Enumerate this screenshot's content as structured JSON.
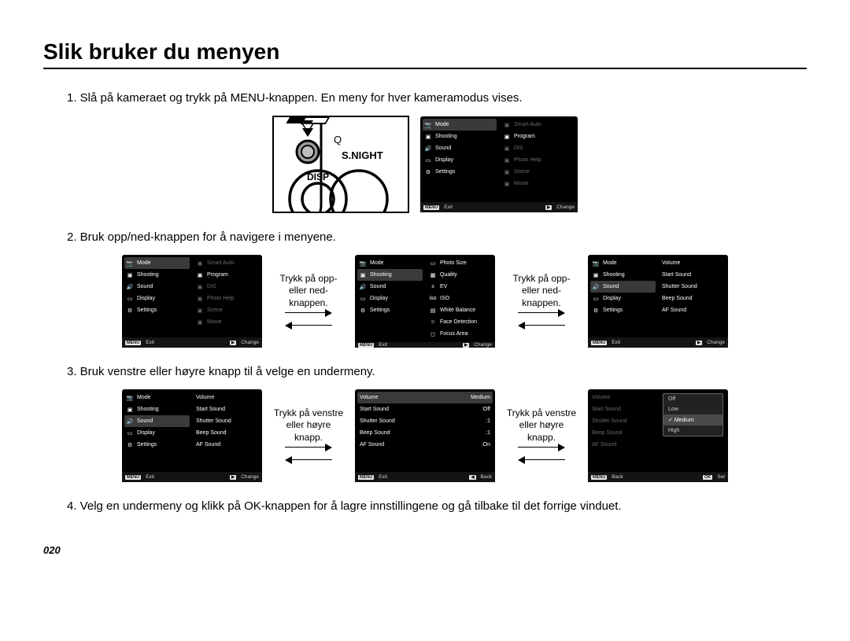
{
  "title": "Slik bruker du menyen",
  "steps": {
    "s1": "1. Slå på kameraet og trykk på MENU-knappen. En meny for hver kameramodus vises.",
    "s2": "2. Bruk opp/ned-knappen for å navigere i menyene.",
    "s3": "3. Bruk venstre eller høyre knapp til å velge en undermeny.",
    "s4": "4. Velg en undermeny og klikk på OK-knappen for å lagre innstillingene og gå tilbake til det forrige vinduet."
  },
  "captions": {
    "updown": "Trykk på opp- eller ned-knappen.",
    "leftright": "Trykk på venstre eller høyre knapp."
  },
  "menuLeft": {
    "mode": "Mode",
    "shooting": "Shooting",
    "sound": "Sound",
    "display": "Display",
    "settings": "Settings"
  },
  "modeRight": {
    "smart": "Smart Auto",
    "program": "Program",
    "dis": "DIS",
    "photohelp": "Photo Help",
    "scene": "Scene",
    "movie": "Movie"
  },
  "shootingRight": {
    "photosize": "Photo Size",
    "quality": "Quality",
    "ev": "EV",
    "iso": "ISO",
    "wb": "White Balance",
    "face": "Face Detection",
    "focus": "Focus Area"
  },
  "soundRight": {
    "volume": "Volume",
    "start": "Start Sound",
    "shutter": "Shutter Sound",
    "beep": "Beep Sound",
    "af": "AF Sound"
  },
  "soundVals": {
    "volume": "Medium",
    "start": ":Off",
    "shutter": ":1",
    "beep": ":1",
    "af": ":On"
  },
  "volOpts": {
    "off": "Off",
    "low": "Low",
    "med": "Medium",
    "high": "High"
  },
  "foot": {
    "menu": "MENU",
    "exit": "Exit",
    "change": "Change",
    "back": "Back",
    "ok": "OK",
    "set": "Set",
    "play": "▶"
  },
  "cameraLabels": {
    "snight": "S.NIGHT",
    "disp": "DISP",
    "zoom": "Q"
  },
  "pagenum": "020"
}
